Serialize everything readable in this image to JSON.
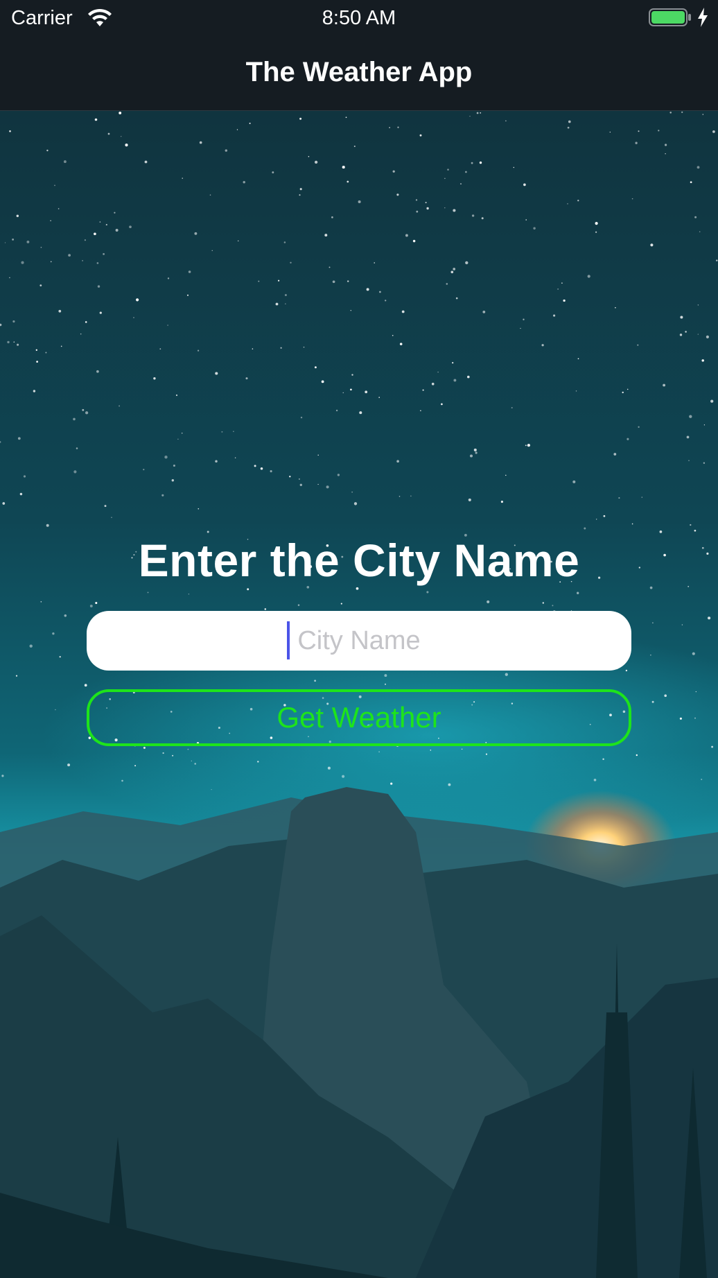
{
  "status_bar": {
    "carrier": "Carrier",
    "time": "8:50 AM",
    "battery_color": "#4cd964",
    "icons": [
      "wifi-icon",
      "battery-icon",
      "charging-bolt-icon"
    ]
  },
  "nav": {
    "title": "The Weather App"
  },
  "main": {
    "heading": "Enter the City Name",
    "city_input": {
      "placeholder": "City Name",
      "value": ""
    },
    "get_weather_label": "Get Weather",
    "accent_color": "#1ee41b"
  },
  "background": {
    "scene": "night-sky-mountain-icon"
  }
}
